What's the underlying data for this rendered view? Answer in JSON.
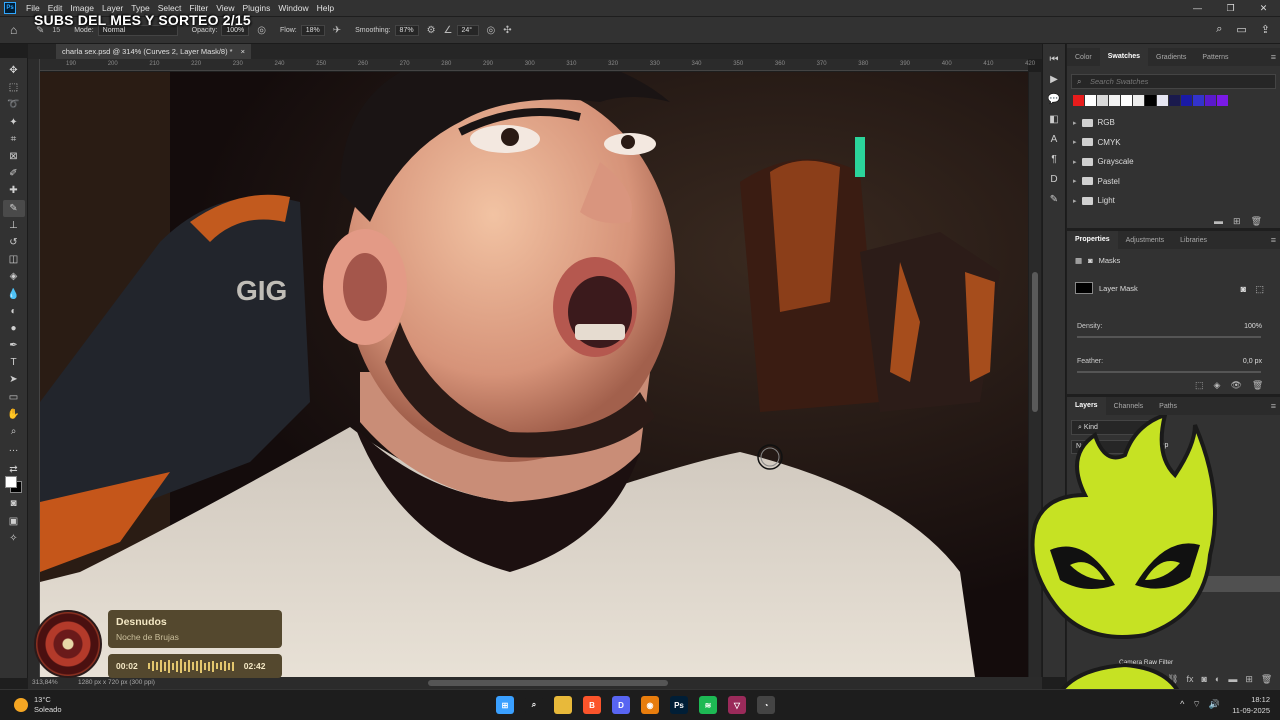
{
  "menubar": {
    "logo": "Ps",
    "items": [
      "File",
      "Edit",
      "Image",
      "Layer",
      "Type",
      "Select",
      "Filter",
      "View",
      "Plugins",
      "Window",
      "Help"
    ]
  },
  "overlay_title": "SUBS DEL MES Y SORTEO 2/15",
  "options": {
    "brush_size": "15",
    "mode_label": "Mode:",
    "mode_value": "Normal",
    "opacity_label": "Opacity:",
    "opacity_value": "100%",
    "flow_label": "Flow:",
    "flow_value": "18%",
    "smoothing_label": "Smoothing:",
    "smoothing_value": "87%",
    "angle_value": "24°"
  },
  "document": {
    "tab_title": "charla sex.psd @ 314% (Curves 2, Layer Mask/8) *",
    "tab_close": "×",
    "ruler_ticks": [
      "190",
      "200",
      "210",
      "220",
      "230",
      "240",
      "250",
      "260",
      "270",
      "280",
      "290",
      "300",
      "310",
      "320",
      "330",
      "340",
      "350",
      "360",
      "370",
      "380",
      "390",
      "400",
      "410",
      "420"
    ]
  },
  "status": {
    "zoom": "313,84%",
    "dims": "1280 px x 720 px (300 ppi)"
  },
  "panels": {
    "swatch_tabs": [
      "Color",
      "Swatches",
      "Gradients",
      "Patterns"
    ],
    "swatch_active": 1,
    "search_placeholder": "Search Swatches",
    "swatch_colors": [
      "#e81c1c",
      "#ffffff",
      "#d9d9d9",
      "#f2f2f2",
      "#ffffff",
      "#ededed",
      "#000000",
      "#e6e6f2",
      "#1a1a4d",
      "#1a1aa6",
      "#3333cc",
      "#5a1acc",
      "#7a1ae6"
    ],
    "swatch_groups": [
      "RGB",
      "CMYK",
      "Grayscale",
      "Pastel",
      "Light"
    ],
    "prop_tabs": [
      "Properties",
      "Adjustments",
      "Libraries"
    ],
    "prop_active": 0,
    "masks_label": "Masks",
    "layer_mask_label": "Layer Mask",
    "density_label": "Density:",
    "density_value": "100%",
    "feather_label": "Feather:",
    "feather_value": "0,0 px",
    "layer_tabs": [
      "Layers",
      "Channels",
      "Paths"
    ],
    "layer_active": 0,
    "kind_label": "Kind",
    "blend_short": "Nor",
    "opacity_short": "Op",
    "camera_raw": "Camera Raw Filter"
  },
  "music": {
    "title": "Desnudos",
    "artist": "Noche de Brujas",
    "elapsed": "00:02",
    "duration": "02:42"
  },
  "taskbar": {
    "temp": "13°C",
    "condition": "Soleado",
    "time": "18:12",
    "date": "11-09-2025",
    "apps": [
      {
        "name": "windows-start",
        "color": "#3aa0ff",
        "glyph": "⊞"
      },
      {
        "name": "search",
        "color": "#1d1d1d",
        "glyph": "⌕"
      },
      {
        "name": "file-explorer",
        "color": "#e8b93a",
        "glyph": ""
      },
      {
        "name": "brave",
        "color": "#fb542b",
        "glyph": "B"
      },
      {
        "name": "discord",
        "color": "#5865f2",
        "glyph": "D"
      },
      {
        "name": "blender",
        "color": "#e87d0d",
        "glyph": "◉"
      },
      {
        "name": "photoshop",
        "color": "#001e36",
        "glyph": "Ps"
      },
      {
        "name": "spotify",
        "color": "#1db954",
        "glyph": "≋"
      },
      {
        "name": "app-pink",
        "color": "#9a2a5a",
        "glyph": "▽"
      },
      {
        "name": "app-circle",
        "color": "#444",
        "glyph": "◔"
      }
    ]
  }
}
